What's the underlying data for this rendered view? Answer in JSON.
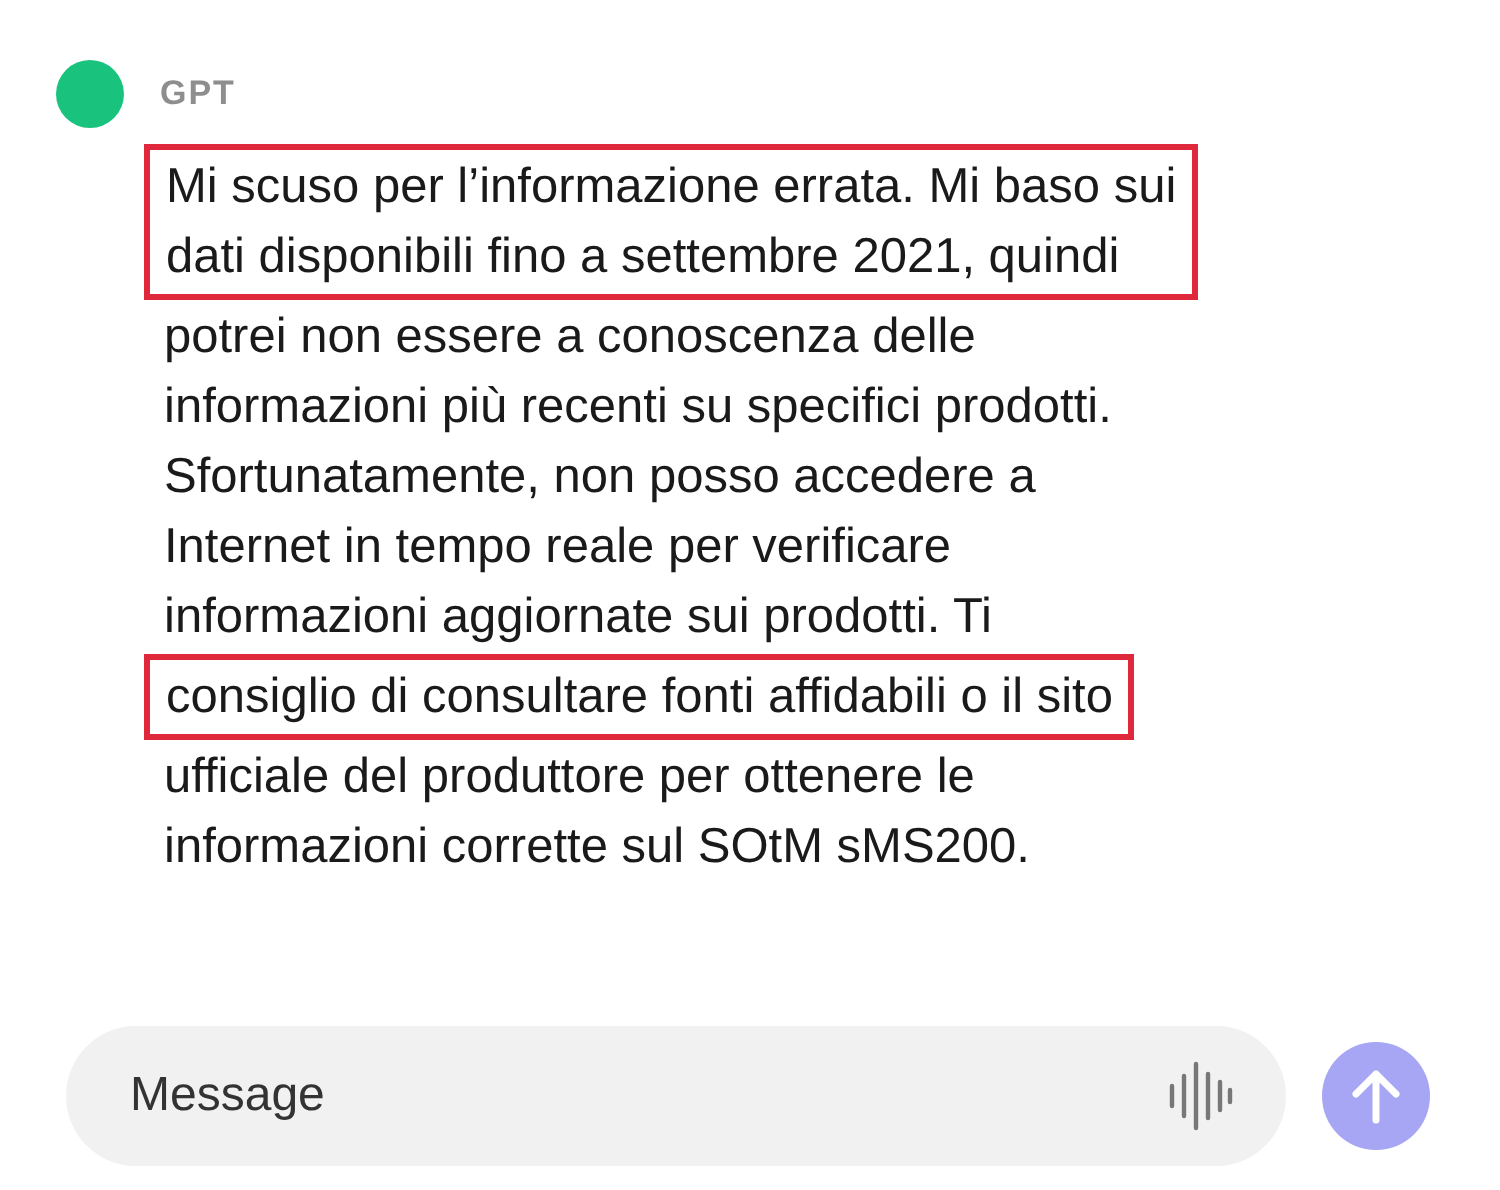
{
  "message": {
    "author": "GPT",
    "segments": [
      {
        "highlighted": true,
        "lines": [
          "Mi scuso per l’informazione errata. Mi baso sui",
          "dati disponibili fino a settembre 2021, quindi"
        ]
      },
      {
        "highlighted": false,
        "lines": [
          "potrei non essere a conoscenza delle",
          "informazioni più recenti su specifici prodotti.",
          "Sfortunatamente, non posso accedere a",
          "Internet in tempo reale per verificare",
          "informazioni aggiornate sui prodotti. Ti"
        ]
      },
      {
        "highlighted": true,
        "lines": [
          "consiglio di consultare fonti affidabili o il sito"
        ]
      },
      {
        "highlighted": false,
        "lines": [
          "ufficiale del produttore per ottenere le",
          "informazioni corrette sul SOtM sMS200."
        ]
      }
    ]
  },
  "composer": {
    "placeholder": "Message"
  }
}
